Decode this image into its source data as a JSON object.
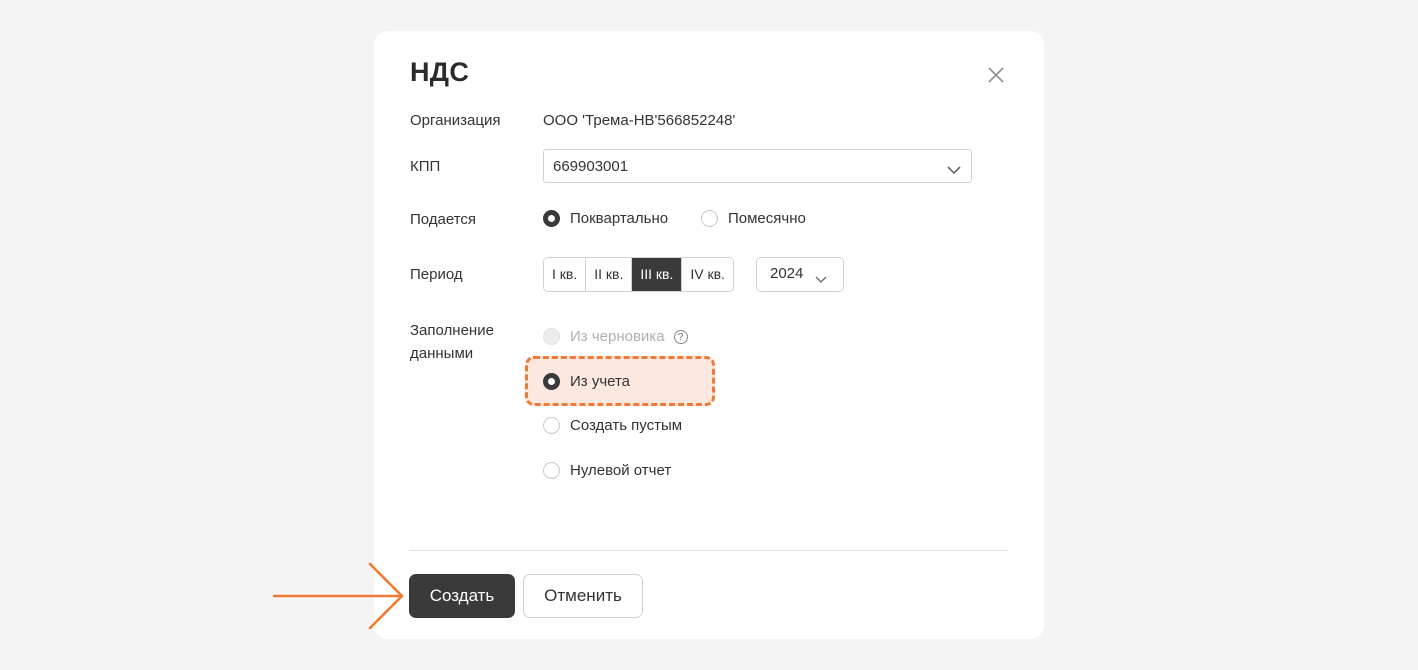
{
  "dialog": {
    "title": "НДС",
    "close_icon": "close-icon"
  },
  "fields": {
    "organization": {
      "label": "Организация",
      "value": "ООО 'Трема-НВ'566852248'"
    },
    "kpp": {
      "label": "КПП",
      "value": "669903001"
    },
    "submission": {
      "label": "Подается",
      "options": [
        "Поквартально",
        "Помесячно"
      ],
      "selected": "Поквартально"
    },
    "period": {
      "label": "Период",
      "quarters": [
        "I кв.",
        "II кв.",
        "III кв.",
        "IV кв."
      ],
      "selected_quarter": "III кв.",
      "year": "2024"
    },
    "fill": {
      "label_line1": "Заполнение",
      "label_line2": "данными",
      "options": [
        "Из черновика",
        "Из учета",
        "Создать пустым",
        "Нулевой отчет"
      ],
      "selected": "Из учета",
      "disabled": "Из черновика",
      "help_icon": "help-circle-icon"
    }
  },
  "buttons": {
    "create": "Создать",
    "cancel": "Отменить"
  },
  "colors": {
    "primary": "#3a3a3a",
    "highlight_border": "#f07a35",
    "highlight_fill": "#fde8df",
    "arrow": "#f07a35"
  }
}
